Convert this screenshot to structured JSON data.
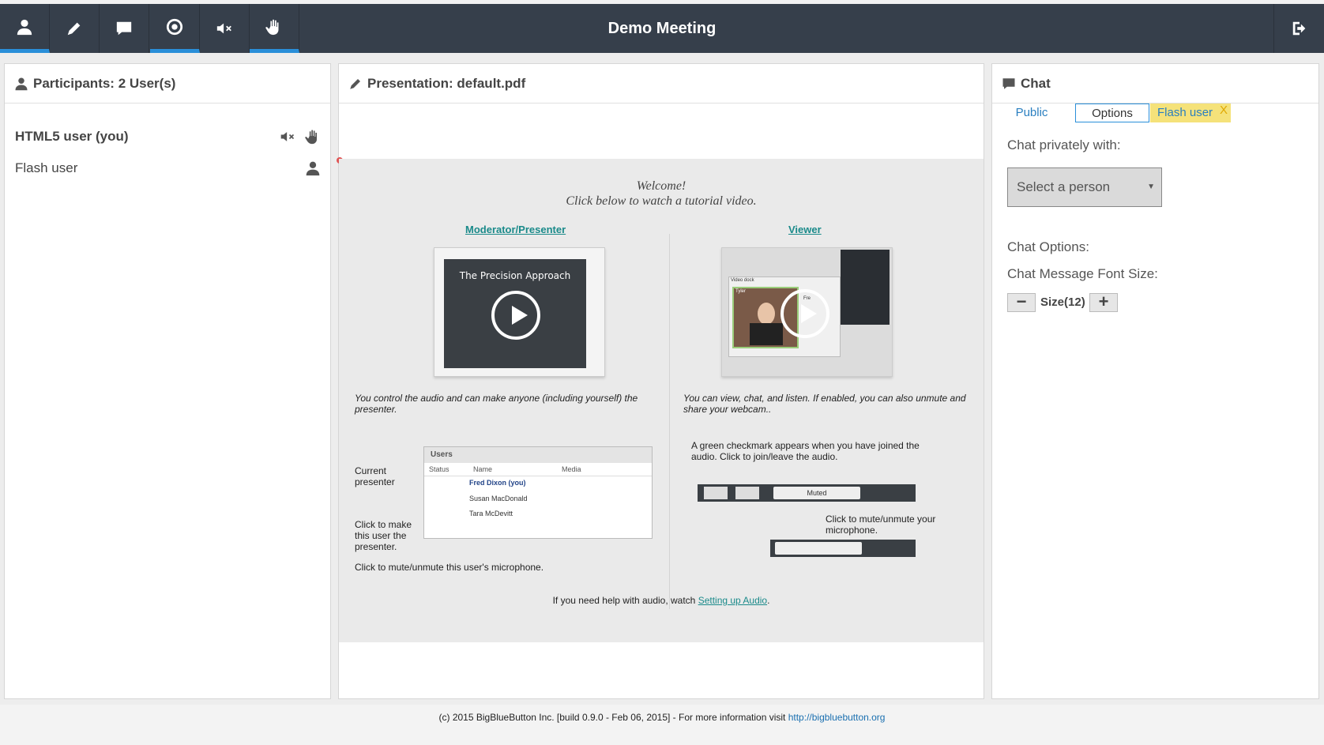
{
  "meeting": {
    "title": "Demo Meeting"
  },
  "toolbar": {
    "buttons": [
      {
        "name": "users",
        "active": true
      },
      {
        "name": "presentation",
        "active": true
      },
      {
        "name": "chat",
        "active": true
      },
      {
        "name": "settings",
        "active": true
      },
      {
        "name": "mute",
        "active": false
      },
      {
        "name": "raise-hand",
        "active": true
      }
    ]
  },
  "participants": {
    "title": "Participants: 2 User(s)",
    "users": [
      {
        "name": "HTML5 user (you)",
        "bold": true,
        "icons": [
          "muted-icon",
          "hand-icon"
        ]
      },
      {
        "name": "Flash user",
        "bold": false,
        "icons": [
          "user-icon"
        ]
      }
    ]
  },
  "presentation": {
    "title": "Presentation: default.pdf",
    "slide": {
      "welcome": "Welcome!",
      "subtitle": "Click below to watch a tutorial video.",
      "moderator_link": "Moderator/Presenter",
      "viewer_link": "Viewer",
      "moderator_video_title": "The Precision Approach",
      "moderator_desc": "You control the audio and can make anyone (including yourself) the presenter.",
      "viewer_desc": "You can view, chat, and listen.  If enabled, you can also unmute and share your webcam..",
      "users_window": {
        "title": "Users",
        "columns": [
          "Status",
          "Name",
          "Media"
        ],
        "rows": [
          "Fred Dixon (you)",
          "Susan MacDonald",
          "Tara McDevitt"
        ]
      },
      "current_presenter": "Current presenter",
      "click_make_presenter": "Click to make this user the presenter.",
      "click_mute_user": "Click to mute/unmute this user's microphone.",
      "green_check_note": "A green checkmark appears when you have joined the audio.  Click to join/leave the audio.",
      "muted_label": "Muted",
      "click_mute_yours": "Click to mute/unmute your microphone.",
      "help_prefix": "If you need help with audio, watch ",
      "help_link": "Setting up Audio",
      "help_suffix": ".",
      "video_dock": "Video dock",
      "tyler": "Tyler",
      "fre": "Fre"
    }
  },
  "chat": {
    "title": "Chat",
    "tabs": {
      "public": "Public",
      "options": "Options",
      "flash_user": "Flash user",
      "close": "X"
    },
    "chat_privately": "Chat privately with:",
    "select_person": "Select a person",
    "chat_options": "Chat Options:",
    "font_size_label": "Chat Message Font Size:",
    "font_size_value": "Size(12)",
    "minus": "−",
    "plus": "+"
  },
  "footer": {
    "text": "(c) 2015 BigBlueButton Inc. [build 0.9.0 - Feb 06, 2015] - For more information visit ",
    "link": "http://bigbluebutton.org"
  },
  "colors": {
    "topbar": "#363f4b",
    "accent": "#2a8fd9",
    "flash_tab": "#f5e27a",
    "link": "#1a8a8a"
  }
}
